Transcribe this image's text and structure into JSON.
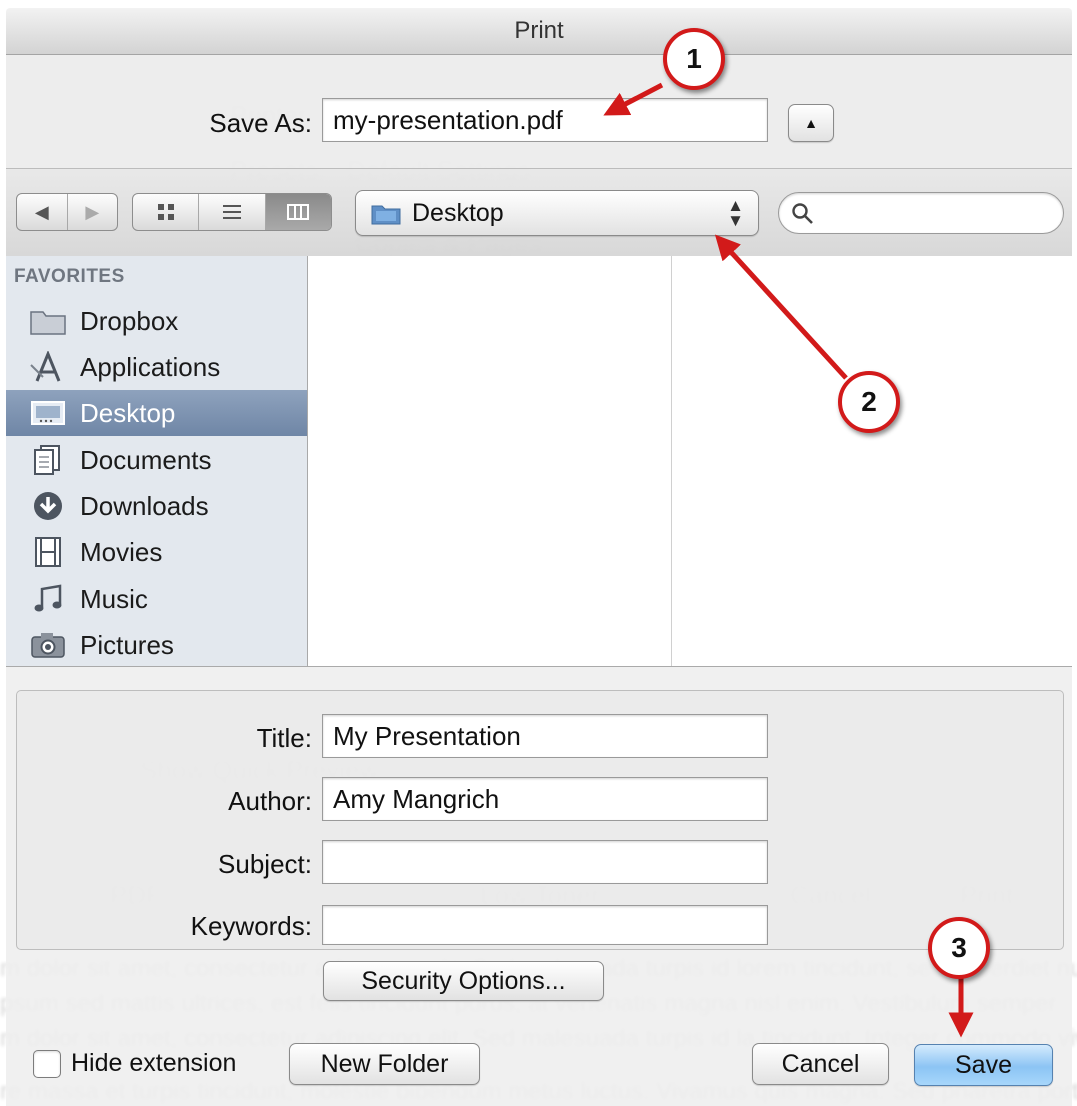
{
  "window": {
    "title": "Print"
  },
  "save_as": {
    "label": "Save As:",
    "value": "my-presentation.pdf"
  },
  "toolbar": {
    "location": "Desktop",
    "search_placeholder": ""
  },
  "sidebar": {
    "heading": "FAVORITES",
    "items": [
      {
        "label": "Dropbox",
        "icon": "folder-icon"
      },
      {
        "label": "Applications",
        "icon": "applications-icon"
      },
      {
        "label": "Desktop",
        "icon": "desktop-icon",
        "selected": true
      },
      {
        "label": "Documents",
        "icon": "documents-icon"
      },
      {
        "label": "Downloads",
        "icon": "downloads-icon"
      },
      {
        "label": "Movies",
        "icon": "movies-icon"
      },
      {
        "label": "Music",
        "icon": "music-icon"
      },
      {
        "label": "Pictures",
        "icon": "pictures-icon"
      }
    ]
  },
  "metadata": {
    "title_label": "Title:",
    "title_value": "My Presentation",
    "author_label": "Author:",
    "author_value": "Amy Mangrich",
    "subject_label": "Subject:",
    "subject_value": "",
    "keywords_label": "Keywords:",
    "keywords_value": "",
    "security_button": "Security Options..."
  },
  "footer": {
    "hide_extension_label": "Hide extension",
    "new_folder_button": "New Folder",
    "cancel_button": "Cancel",
    "save_button": "Save"
  },
  "annotations": [
    "1",
    "2",
    "3"
  ],
  "colors": {
    "arrow": "#d21a1a",
    "sidebar_selected": "#7d93b2",
    "save_button": "#8cc4f4"
  }
}
